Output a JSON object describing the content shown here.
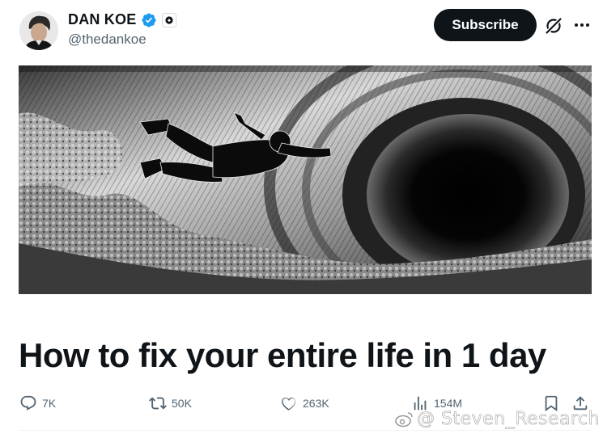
{
  "author": {
    "name": "DAN KOE",
    "handle": "@thedankoe"
  },
  "header": {
    "subscribe_label": "Subscribe"
  },
  "icons": {
    "verified": "verified-badge-icon",
    "affiliate": "affiliate-badge-icon",
    "grok": "grok-icon",
    "more": "more-icon",
    "reply": "reply-icon",
    "repost": "repost-icon",
    "like": "like-icon",
    "views": "views-icon",
    "bookmark": "bookmark-icon",
    "share": "share-icon"
  },
  "colors": {
    "verified": "#1d9bf0",
    "text": "#0f1419",
    "secondary": "#536471"
  },
  "article": {
    "title": "How to fix your entire life in 1 day"
  },
  "actions": {
    "replies": "7K",
    "reposts": "50K",
    "likes": "263K",
    "views": "154M"
  },
  "watermark": {
    "text": "@ Steven_Research"
  }
}
